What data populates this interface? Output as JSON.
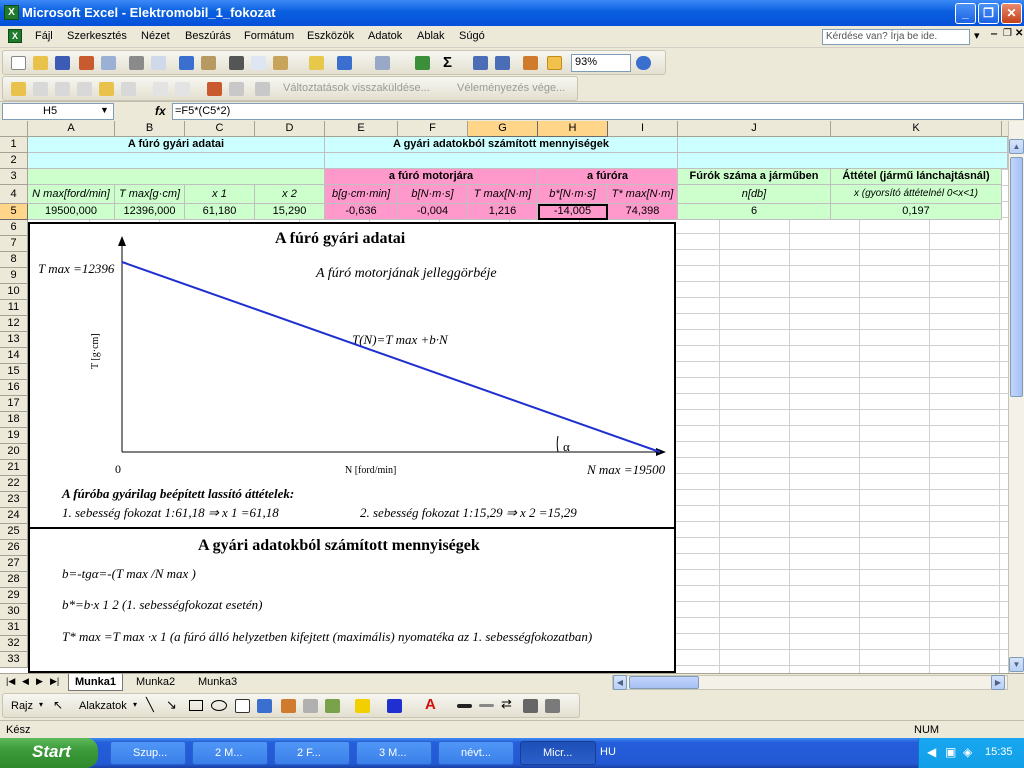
{
  "window": {
    "title": "Microsoft Excel - Elektromobil_1_fokozat"
  },
  "menu": [
    "Fájl",
    "Szerkesztés",
    "Nézet",
    "Beszúrás",
    "Formátum",
    "Eszközök",
    "Adatok",
    "Ablak",
    "Súgó"
  ],
  "help": {
    "placeholder": "Kérdése van? Írja be ide."
  },
  "toolbar": {
    "zoom": "93%",
    "review_label": "Változtatások visszaküldése...",
    "review2_label": "Véleményezés vége..."
  },
  "formula": {
    "cell": "H5",
    "fx": "fx",
    "content": "=F5*(C5*2)"
  },
  "columns": [
    "A",
    "B",
    "C",
    "D",
    "E",
    "F",
    "G",
    "H",
    "I",
    "J",
    "K"
  ],
  "rows": [
    "1",
    "2",
    "3",
    "4",
    "5",
    "6",
    "7",
    "8",
    "9",
    "10",
    "11",
    "12",
    "13",
    "14",
    "15",
    "16",
    "17",
    "18",
    "19",
    "20",
    "21",
    "22",
    "23",
    "24",
    "25",
    "26",
    "27",
    "28",
    "29",
    "30",
    "31",
    "32",
    "33"
  ],
  "sheet": {
    "r1": {
      "a": "A fúró gyári adatai",
      "b": "A gyári adatokból számított mennyiségek"
    },
    "r3": {
      "e": "a fúró motorjára",
      "h": "a fúróra",
      "j": "Fúrók száma a járműben",
      "k": "Áttétel (jármű lánchajtásnál)"
    },
    "r4": {
      "a": "N max[ford/min]",
      "b": "T max[g·cm]",
      "c": "x 1",
      "d": "x 2",
      "e": "b[g·cm·min]",
      "f": "b[N·m·s]",
      "g": "T max[N·m]",
      "h": "b*[N·m·s]",
      "i": "T* max[N·m]",
      "j": "n[db]",
      "k": "x (gyorsító áttételnél 0<x<1)"
    },
    "r5": {
      "a": "19500,000",
      "b": "12396,000",
      "c": "61,180",
      "d": "15,290",
      "e": "-0,636",
      "f": "-0,004",
      "g": "1,216",
      "h": "-14,005",
      "i": "74,398",
      "j": "6",
      "k": "0,197"
    }
  },
  "chart": {
    "title1": "A fúró gyári adatai",
    "subtitle": "A fúró motorjának jelleggörbéje",
    "tmax_label": "T max =12396",
    "formula": "T(N)=T max +b·N",
    "ylabel": "T [g·cm]",
    "xlabel": "N [ford/min]",
    "origin": "0",
    "nmax_label": "N max =19500",
    "alpha": "α",
    "gears_title": "A fúróba gyárilag beépített lassító áttételek:",
    "gear1": "1. sebesség fokozat 1:61,18 ⇒ x 1 =61,18",
    "gear2": "2. sebesség fokozat 1:15,29 ⇒ x 2 =15,29",
    "title2": "A gyári adatokból számított mennyiségek",
    "eq1": "b=-tgα=-(T max /N max )",
    "eq2": "b*=b·x 1 2 (1. sebességfokozat esetén)",
    "eq3": "T* max =T max ·x 1 (a fúró álló helyzetben kifejtett (maximális) nyomatéka az 1. sebességfokozatban)"
  },
  "chart_data": {
    "type": "line",
    "title": "A fúró motorjának jelleggörbéje",
    "xlabel": "N [ford/min]",
    "ylabel": "T [g·cm]",
    "x": [
      0,
      19500
    ],
    "y": [
      12396,
      0
    ]
  },
  "tabs": [
    "Munka1",
    "Munka2",
    "Munka3"
  ],
  "drawbar": {
    "rajz": "Rajz",
    "alakzatok": "Alakzatok"
  },
  "status": {
    "left": "Kész",
    "num": "NUM"
  },
  "taskbar": {
    "start": "Start",
    "items": [
      "Szup...",
      "2 M...",
      "2 F...",
      "3 M...",
      "névt...",
      "Micr..."
    ],
    "lang": "HU",
    "clock": "15:35"
  }
}
